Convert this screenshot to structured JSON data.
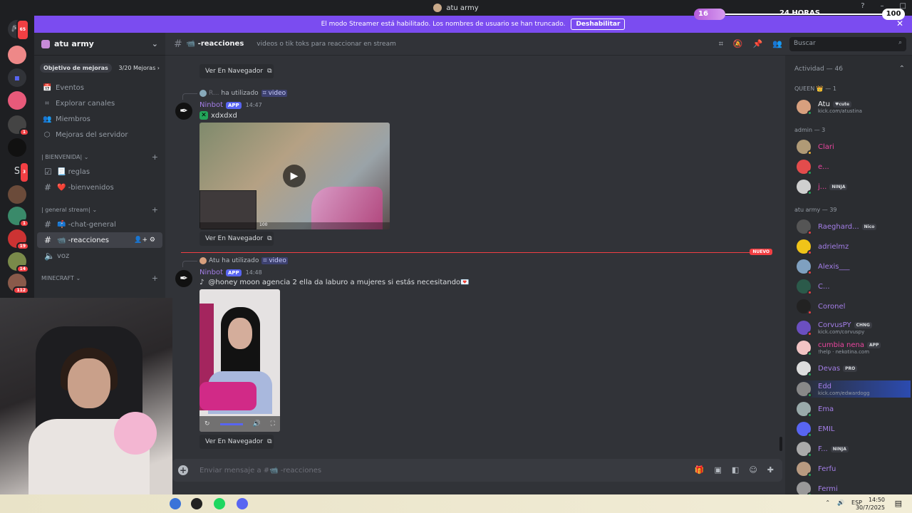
{
  "window": {
    "title": "atu army",
    "controls": [
      "—",
      "?",
      "–",
      "□"
    ]
  },
  "timer": {
    "left": "16",
    "center": "24 HORAS",
    "right": "100"
  },
  "banner": {
    "text": "El modo Streamer está habilitado. Los nombres de usuario se han truncado.",
    "button": "Deshabilitar",
    "close": "✕"
  },
  "guilds": {
    "badges": [
      "65",
      "1",
      "3",
      "1",
      "19",
      "14",
      "112"
    ],
    "home_initial": "S"
  },
  "server": {
    "name": "atu army",
    "boost_label": "Objetivo de mejoras",
    "boost_count": "3/20 Mejoras",
    "nav": [
      {
        "icon": "📅",
        "label": "Eventos"
      },
      {
        "icon": "⌗",
        "label": "Explorar canales"
      },
      {
        "icon": "👥",
        "label": "Miembros"
      },
      {
        "icon": "⬡",
        "label": "Mejoras del servidor"
      }
    ],
    "categories": [
      {
        "name": "| BIENVENIDA|",
        "channels": [
          "📃 reglas",
          "❤️ -bienvenidos"
        ]
      },
      {
        "name": "| general stream|",
        "channels": [
          "📫 -chat-general",
          "📹 -reacciones",
          "voz"
        ]
      },
      {
        "name": "MINECRAFT",
        "channels": []
      }
    ]
  },
  "channel": {
    "name": "📹 -reacciones",
    "topic": "videos o tik toks para reaccionar en stream",
    "search_placeholder": "Buscar"
  },
  "messages": [
    {
      "reply_user": "R...",
      "reply_action": "ha utilizado",
      "reply_cmd": "⌗ video",
      "author": "Ninbot",
      "tag": "APP",
      "time": "14:47",
      "text": "xdxdxd",
      "hud_text": "100",
      "link": "Ver En Navegador"
    },
    {
      "reply_user": "Atu",
      "reply_action": "ha utilizado",
      "reply_cmd": "⌗ video",
      "author": "Ninbot",
      "tag": "APP",
      "time": "14:48",
      "text": "@honey moon agencia 2 ella da laburo a mujeres si estás necesitando💌",
      "link": "Ver En Navegador"
    }
  ],
  "previous_link": "Ver En Navegador",
  "new_divider": "NUEVO",
  "composer": {
    "placeholder": "Enviar mensaje a #📹 -reacciones"
  },
  "members": {
    "header": "Actividad — 46",
    "groups": [
      {
        "name": "QUEEN 👑 — 1"
      },
      {
        "name": "admin — 3"
      },
      {
        "name": "atu army — 39"
      }
    ],
    "list": [
      {
        "name": "Atu",
        "tag": "♥cute",
        "sub": "kick.com/atustina",
        "color": "#f2f3f5",
        "avatar": "#d8a07e",
        "status": "#23a55a"
      },
      {
        "name": "Clari",
        "tag": "",
        "sub": "",
        "color": "#eb459f",
        "avatar": "#b09a76",
        "status": "#f0b232"
      },
      {
        "name": "e...",
        "tag": "",
        "sub": "",
        "color": "#eb459f",
        "avatar": "#e34c4c",
        "status": "#23a55a"
      },
      {
        "name": "j...",
        "tag": "NINJA",
        "sub": "",
        "color": "#eb459f",
        "avatar": "#cfcfcf",
        "status": "#23a55a"
      },
      {
        "name": "Raeghard...",
        "tag": "Nico",
        "sub": "",
        "color": "#a47ee8",
        "avatar": "#555",
        "status": "#f23f43"
      },
      {
        "name": "adrielmz",
        "tag": "",
        "sub": "",
        "color": "#a47ee8",
        "avatar": "#f0c419",
        "status": "#f23f43"
      },
      {
        "name": "Alexis___",
        "tag": "",
        "sub": "",
        "color": "#a47ee8",
        "avatar": "#7fa0c0",
        "status": "#f23f43"
      },
      {
        "name": "C...",
        "tag": "",
        "sub": "",
        "color": "#a47ee8",
        "avatar": "#2b5a4a",
        "status": "#f23f43"
      },
      {
        "name": "Coronel",
        "tag": "",
        "sub": "",
        "color": "#a47ee8",
        "avatar": "#222",
        "status": "#f23f43"
      },
      {
        "name": "CorvusPY",
        "tag": "CHNG",
        "sub": "kick.com/corvuspy",
        "color": "#a47ee8",
        "avatar": "#6b4fc0",
        "status": "#f23f43"
      },
      {
        "name": "cumbia nena",
        "tag": "APP",
        "sub": "!help · nekotina.com",
        "color": "#eb459f",
        "avatar": "#f2c4c4",
        "status": "#23a55a"
      },
      {
        "name": "Devas",
        "tag": "PRO",
        "sub": "",
        "color": "#a47ee8",
        "avatar": "#ddd",
        "status": "#23a55a"
      },
      {
        "name": "Edd",
        "tag": "",
        "sub": "kick.com/edwardogg",
        "color": "#a47ee8",
        "avatar": "#888",
        "status": "#23a55a"
      },
      {
        "name": "Ema",
        "tag": "",
        "sub": "",
        "color": "#a47ee8",
        "avatar": "#9aa",
        "status": "#23a55a"
      },
      {
        "name": "EMIL",
        "tag": "",
        "sub": "",
        "color": "#a47ee8",
        "avatar": "#5865f2",
        "status": "#23a55a"
      },
      {
        "name": "F...",
        "tag": "NINJA",
        "sub": "",
        "color": "#a47ee8",
        "avatar": "#aaa",
        "status": "#23a55a"
      },
      {
        "name": "Ferfu",
        "tag": "",
        "sub": "",
        "color": "#a47ee8",
        "avatar": "#b89a80",
        "status": "#23a55a"
      },
      {
        "name": "Fermi",
        "tag": "",
        "sub": "",
        "color": "#a47ee8",
        "avatar": "#999",
        "status": "#23a55a"
      }
    ]
  },
  "taskbar": {
    "lang": "ESP",
    "time": "14:50",
    "date": "30/7/2025"
  }
}
